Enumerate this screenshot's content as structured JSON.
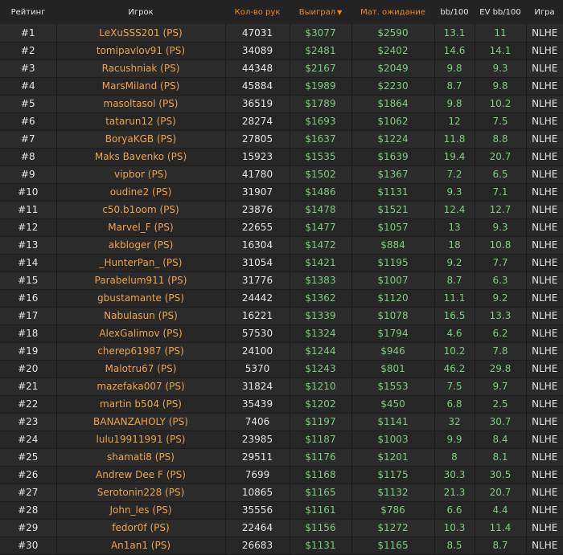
{
  "headers": {
    "rank": "Рейтинг",
    "player": "Игрок",
    "hands": "Кол-во рук",
    "won": "Выиграл",
    "ev": "Мат. ожидание",
    "bb100": "bb/100",
    "evbb100": "EV bb/100",
    "game": "Игра"
  },
  "sort_arrow": "▼",
  "rows": [
    {
      "rank": "#1",
      "player": "LeXuSSS201 (PS)",
      "hands": "47031",
      "won": "$3077",
      "ev": "$2590",
      "bb": "13.1",
      "evbb": "11",
      "game": "NLHE"
    },
    {
      "rank": "#2",
      "player": "tomipavlov91 (PS)",
      "hands": "34089",
      "won": "$2481",
      "ev": "$2402",
      "bb": "14.6",
      "evbb": "14.1",
      "game": "NLHE"
    },
    {
      "rank": "#3",
      "player": "Racushniak (PS)",
      "hands": "44348",
      "won": "$2167",
      "ev": "$2049",
      "bb": "9.8",
      "evbb": "9.3",
      "game": "NLHE"
    },
    {
      "rank": "#4",
      "player": "MarsMiland (PS)",
      "hands": "45884",
      "won": "$1989",
      "ev": "$2230",
      "bb": "8.7",
      "evbb": "9.8",
      "game": "NLHE"
    },
    {
      "rank": "#5",
      "player": "masoltasol (PS)",
      "hands": "36519",
      "won": "$1789",
      "ev": "$1864",
      "bb": "9.8",
      "evbb": "10.2",
      "game": "NLHE"
    },
    {
      "rank": "#6",
      "player": "tatarun12 (PS)",
      "hands": "28274",
      "won": "$1693",
      "ev": "$1062",
      "bb": "12",
      "evbb": "7.5",
      "game": "NLHE"
    },
    {
      "rank": "#7",
      "player": "BoryaKGB (PS)",
      "hands": "27805",
      "won": "$1637",
      "ev": "$1224",
      "bb": "11.8",
      "evbb": "8.8",
      "game": "NLHE"
    },
    {
      "rank": "#8",
      "player": "Maks Bavenko (PS)",
      "hands": "15923",
      "won": "$1535",
      "ev": "$1639",
      "bb": "19.4",
      "evbb": "20.7",
      "game": "NLHE"
    },
    {
      "rank": "#9",
      "player": "vipbor (PS)",
      "hands": "41780",
      "won": "$1502",
      "ev": "$1367",
      "bb": "7.2",
      "evbb": "6.5",
      "game": "NLHE"
    },
    {
      "rank": "#10",
      "player": "oudine2 (PS)",
      "hands": "31907",
      "won": "$1486",
      "ev": "$1131",
      "bb": "9.3",
      "evbb": "7.1",
      "game": "NLHE"
    },
    {
      "rank": "#11",
      "player": "c50.b1oom (PS)",
      "hands": "23876",
      "won": "$1478",
      "ev": "$1521",
      "bb": "12.4",
      "evbb": "12.7",
      "game": "NLHE"
    },
    {
      "rank": "#12",
      "player": "Marvel_F (PS)",
      "hands": "22655",
      "won": "$1477",
      "ev": "$1057",
      "bb": "13",
      "evbb": "9.3",
      "game": "NLHE"
    },
    {
      "rank": "#13",
      "player": "akbloger (PS)",
      "hands": "16304",
      "won": "$1472",
      "ev": "$884",
      "bb": "18",
      "evbb": "10.8",
      "game": "NLHE"
    },
    {
      "rank": "#14",
      "player": "_HunterPan_ (PS)",
      "hands": "31054",
      "won": "$1421",
      "ev": "$1195",
      "bb": "9.2",
      "evbb": "7.7",
      "game": "NLHE"
    },
    {
      "rank": "#15",
      "player": "Parabelum911 (PS)",
      "hands": "31776",
      "won": "$1383",
      "ev": "$1007",
      "bb": "8.7",
      "evbb": "6.3",
      "game": "NLHE"
    },
    {
      "rank": "#16",
      "player": "gbustamante (PS)",
      "hands": "24442",
      "won": "$1362",
      "ev": "$1120",
      "bb": "11.1",
      "evbb": "9.2",
      "game": "NLHE"
    },
    {
      "rank": "#17",
      "player": "Nabulasun (PS)",
      "hands": "16221",
      "won": "$1339",
      "ev": "$1078",
      "bb": "16.5",
      "evbb": "13.3",
      "game": "NLHE"
    },
    {
      "rank": "#18",
      "player": "AlexGalimov (PS)",
      "hands": "57530",
      "won": "$1324",
      "ev": "$1794",
      "bb": "4.6",
      "evbb": "6.2",
      "game": "NLHE"
    },
    {
      "rank": "#19",
      "player": "cherep61987 (PS)",
      "hands": "24100",
      "won": "$1244",
      "ev": "$946",
      "bb": "10.2",
      "evbb": "7.8",
      "game": "NLHE"
    },
    {
      "rank": "#20",
      "player": "Malotru67 (PS)",
      "hands": "5370",
      "won": "$1243",
      "ev": "$801",
      "bb": "46.2",
      "evbb": "29.8",
      "game": "NLHE"
    },
    {
      "rank": "#21",
      "player": "mazefaka007 (PS)",
      "hands": "31824",
      "won": "$1210",
      "ev": "$1553",
      "bb": "7.5",
      "evbb": "9.7",
      "game": "NLHE"
    },
    {
      "rank": "#22",
      "player": "martin b504 (PS)",
      "hands": "35439",
      "won": "$1202",
      "ev": "$450",
      "bb": "6.8",
      "evbb": "2.5",
      "game": "NLHE"
    },
    {
      "rank": "#23",
      "player": "BANANZAHOLY (PS)",
      "hands": "7406",
      "won": "$1197",
      "ev": "$1141",
      "bb": "32",
      "evbb": "30.7",
      "game": "NLHE"
    },
    {
      "rank": "#24",
      "player": "lulu19911991 (PS)",
      "hands": "23985",
      "won": "$1187",
      "ev": "$1003",
      "bb": "9.9",
      "evbb": "8.4",
      "game": "NLHE"
    },
    {
      "rank": "#25",
      "player": "shamati8 (PS)",
      "hands": "29511",
      "won": "$1176",
      "ev": "$1201",
      "bb": "8",
      "evbb": "8.1",
      "game": "NLHE"
    },
    {
      "rank": "#26",
      "player": "Andrew Dee F (PS)",
      "hands": "7699",
      "won": "$1168",
      "ev": "$1175",
      "bb": "30.3",
      "evbb": "30.5",
      "game": "NLHE"
    },
    {
      "rank": "#27",
      "player": "Serotonin228 (PS)",
      "hands": "10865",
      "won": "$1165",
      "ev": "$1132",
      "bb": "21.3",
      "evbb": "20.7",
      "game": "NLHE"
    },
    {
      "rank": "#28",
      "player": "John_les (PS)",
      "hands": "35556",
      "won": "$1161",
      "ev": "$786",
      "bb": "6.6",
      "evbb": "4.4",
      "game": "NLHE"
    },
    {
      "rank": "#29",
      "player": "fedor0f (PS)",
      "hands": "22464",
      "won": "$1156",
      "ev": "$1272",
      "bb": "10.3",
      "evbb": "11.4",
      "game": "NLHE"
    },
    {
      "rank": "#30",
      "player": "An1an1 (PS)",
      "hands": "26683",
      "won": "$1131",
      "ev": "$1165",
      "bb": "8.5",
      "evbb": "8.7",
      "game": "NLHE"
    }
  ]
}
